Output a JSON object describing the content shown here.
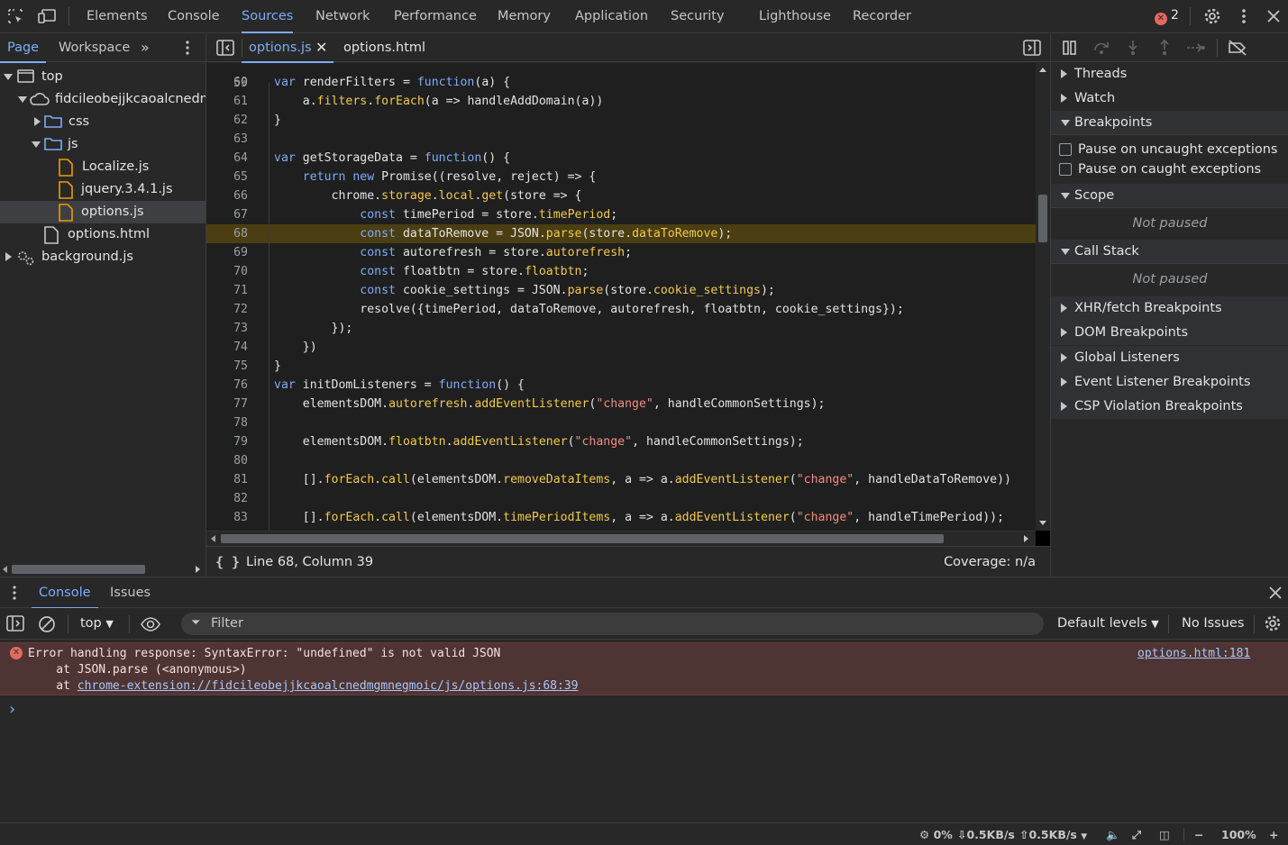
{
  "toolbar": {
    "tabs": [
      "Elements",
      "Console",
      "Sources",
      "Network",
      "Performance",
      "Memory",
      "Application",
      "Security",
      "Lighthouse",
      "Recorder"
    ],
    "active_tab": "Sources",
    "error_count": "2"
  },
  "navigator": {
    "tabs": [
      "Page",
      "Workspace"
    ],
    "tree": [
      {
        "label": "top"
      },
      {
        "label": "fidcileobejjkcaoalcnedmgmnegmoic"
      },
      {
        "label": "css"
      },
      {
        "label": "js"
      },
      {
        "label": "Localize.js"
      },
      {
        "label": "jquery.3.4.1.js"
      },
      {
        "label": "options.js"
      },
      {
        "label": "options.html"
      },
      {
        "label": "background.js"
      }
    ]
  },
  "editor": {
    "tabs": [
      "options.js",
      "options.html"
    ],
    "active_file": "options.js",
    "top_partial_line": "59",
    "lines": [
      {
        "n": "60",
        "text": "var renderFilters = function(a) {"
      },
      {
        "n": "61",
        "text": "    a.filters.forEach(a => handleAddDomain(a))"
      },
      {
        "n": "62",
        "text": "}"
      },
      {
        "n": "63",
        "text": ""
      },
      {
        "n": "64",
        "text": "var getStorageData = function() {"
      },
      {
        "n": "65",
        "text": "    return new Promise((resolve, reject) => {"
      },
      {
        "n": "66",
        "text": "        chrome.storage.local.get(store => {"
      },
      {
        "n": "67",
        "text": "            const timePeriod = store.timePeriod;"
      },
      {
        "n": "68",
        "text": "            const dataToRemove = JSON.parse(store.dataToRemove);"
      },
      {
        "n": "69",
        "text": "            const autorefresh = store.autorefresh;"
      },
      {
        "n": "70",
        "text": "            const floatbtn = store.floatbtn;"
      },
      {
        "n": "71",
        "text": "            const cookie_settings = JSON.parse(store.cookie_settings);"
      },
      {
        "n": "72",
        "text": "            resolve({timePeriod, dataToRemove, autorefresh, floatbtn, cookie_settings});"
      },
      {
        "n": "73",
        "text": "        });"
      },
      {
        "n": "74",
        "text": "    })"
      },
      {
        "n": "75",
        "text": "}"
      },
      {
        "n": "76",
        "text": "var initDomListeners = function() {"
      },
      {
        "n": "77",
        "text": "    elementsDOM.autorefresh.addEventListener(\"change\", handleCommonSettings);"
      },
      {
        "n": "78",
        "text": ""
      },
      {
        "n": "79",
        "text": "    elementsDOM.floatbtn.addEventListener(\"change\", handleCommonSettings);"
      },
      {
        "n": "80",
        "text": ""
      },
      {
        "n": "81",
        "text": "    [].forEach.call(elementsDOM.removeDataItems, a => a.addEventListener(\"change\", handleDataToRemove))"
      },
      {
        "n": "82",
        "text": ""
      },
      {
        "n": "83",
        "text": "    [].forEach.call(elementsDOM.timePeriodItems, a => a.addEventListener(\"change\", handleTimePeriod));"
      }
    ],
    "highlighted_line": "68",
    "status_position": "Line 68, Column 39",
    "coverage": "Coverage: n/a"
  },
  "debugger": {
    "sections": {
      "threads": "Threads",
      "watch": "Watch",
      "breakpoints": "Breakpoints",
      "pause_uncaught": "Pause on uncaught exceptions",
      "pause_caught": "Pause on caught exceptions",
      "scope": "Scope",
      "scope_state": "Not paused",
      "call_stack": "Call Stack",
      "call_stack_state": "Not paused",
      "xhr": "XHR/fetch Breakpoints",
      "dom": "DOM Breakpoints",
      "global": "Global Listeners",
      "event": "Event Listener Breakpoints",
      "csp": "CSP Violation Breakpoints"
    }
  },
  "drawer": {
    "tabs": [
      "Console",
      "Issues"
    ],
    "active_tab": "Console",
    "context": "top",
    "filter_placeholder": "Filter",
    "levels": "Default levels",
    "issues": "No Issues"
  },
  "console": {
    "error_line1": "Error handling response: SyntaxError: \"undefined\" is not valid JSON",
    "error_line2": "    at JSON.parse (<anonymous>)",
    "error_line3_prefix": "    at ",
    "error_line3_link": "chrome-extension://fidcileobejjkcaoalcnedmgmnegmoic/js/options.js:68:39",
    "error_source": "options.html:181",
    "prompt": "›"
  },
  "statusbar": {
    "cpu": "0%",
    "down": "0.5KB/s",
    "up": "0.5KB/s",
    "zoom": "100%"
  },
  "colors": {
    "accent": "#7cacf8",
    "keyword": "#7cacf8",
    "property": "#f2c94c",
    "string": "#f28b82",
    "error_bg": "#4e3534",
    "highlight_line": "#4a3e12"
  }
}
